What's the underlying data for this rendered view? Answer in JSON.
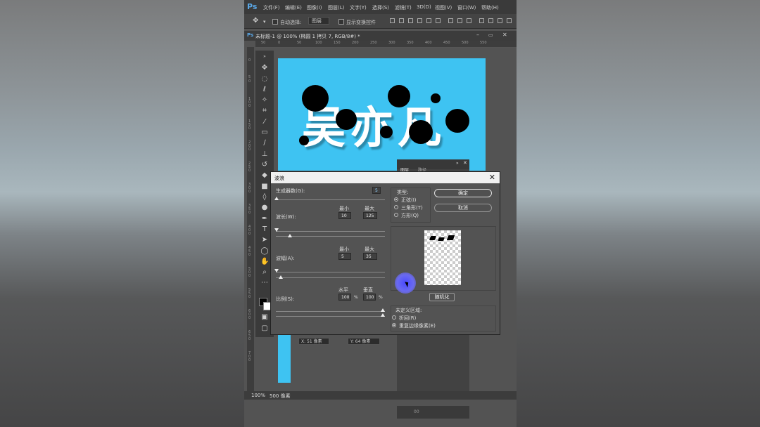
{
  "app": {
    "logo": "Ps",
    "menu": [
      "文件(F)",
      "编辑(E)",
      "图像(I)",
      "图层(L)",
      "文字(Y)",
      "选择(S)",
      "滤镜(T)",
      "3D(D)",
      "视图(V)",
      "窗口(W)",
      "帮助(H)"
    ]
  },
  "options_bar": {
    "auto_select_label": "自动选择:",
    "auto_select_target": "图层",
    "show_transform_label": "显示变换控件"
  },
  "document": {
    "tab_title": "未标题-1 @ 100% (椭圆 1 拷贝 7, RGB/8#) *",
    "canvas_text": "吴亦凡",
    "canvas_color": "#3ec3f2"
  },
  "ruler": {
    "top": [
      "50",
      "0",
      "50",
      "100",
      "150",
      "200",
      "250",
      "300",
      "350",
      "400",
      "450",
      "500",
      "550"
    ],
    "left": [
      "0",
      "5",
      "0",
      "1 0 0",
      "1 5 0",
      "2 0 0",
      "2 5 0",
      "3 0 0",
      "3 5 0",
      "4 0 0",
      "4 5 0",
      "5 0 0",
      "5 5 0",
      "6 0 0",
      "6 5 0",
      "7 0 0"
    ]
  },
  "panels": {
    "tabs": [
      "图层",
      "路径"
    ],
    "footer": "00"
  },
  "info": {
    "x": "X: 51 像素",
    "y": "Y: 64 像素"
  },
  "status": {
    "zoom": "100%",
    "size": "500 像素"
  },
  "dialog": {
    "title": "波浪",
    "generators_label": "生成器数(G):",
    "generators_value": "5",
    "min_label": "最小",
    "max_label": "最大",
    "wavelength_label": "波长(W):",
    "wavelength_min": "10",
    "wavelength_max": "125",
    "amplitude_label": "波幅(A):",
    "amplitude_min": "5",
    "amplitude_max": "35",
    "scale_label": "比例(S):",
    "horizontal_label": "水平",
    "vertical_label": "垂直",
    "scale_h": "100",
    "scale_v": "100",
    "percent": "%",
    "type_label": "类型:",
    "type_options": [
      "正弦(I)",
      "三角形(T)",
      "方形(Q)"
    ],
    "type_selected": "正弦(I)",
    "ok": "确定",
    "cancel": "取消",
    "randomize": "随机化",
    "undefined_label": "未定义区域:",
    "undefined_options": [
      "折回(R)",
      "重复边缘像素(E)"
    ],
    "undefined_selected": "重复边缘像素(E)"
  }
}
